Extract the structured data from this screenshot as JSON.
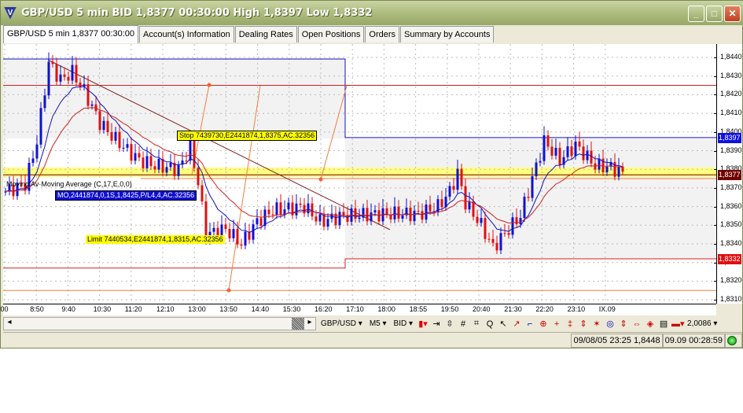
{
  "window": {
    "title": "GBP/USD 5 min BID 1,8377 00:30:00 High 1,8397 Low 1,8332",
    "logo": "FX",
    "buttons": [
      "minimize",
      "maximize",
      "close"
    ]
  },
  "tabs": [
    {
      "label": "GBP/USD 5 min 1,8377 00:30:00",
      "active": true
    },
    {
      "label": "Account(s) Information"
    },
    {
      "label": "Dealing Rates"
    },
    {
      "label": "Open Positions"
    },
    {
      "label": "Orders"
    },
    {
      "label": "Summary by Accounts"
    }
  ],
  "chart": {
    "price_labels": [
      "1,8440",
      "1,8430",
      "1,8420",
      "1,8410",
      "1,8400",
      "1,8390",
      "1,8380",
      "1,8370",
      "1,8360",
      "1,8350",
      "1,8340",
      "1,8330",
      "1,8320",
      "1,8310"
    ],
    "price_values": [
      1.844,
      1.843,
      1.842,
      1.841,
      1.84,
      1.839,
      1.838,
      1.837,
      1.836,
      1.835,
      1.834,
      1.833,
      1.832,
      1.831
    ],
    "badges": [
      {
        "text": "1,8397",
        "value": 1.8397,
        "color": "#1010e0"
      },
      {
        "text": "1,8377",
        "value": 1.8377,
        "color": "#700000"
      },
      {
        "text": "1,8332",
        "value": 1.8332,
        "color": "#e01010"
      }
    ],
    "time_labels": [
      ":00",
      "8:50",
      "9:40",
      "10:30",
      "11:20",
      "12:10",
      "13:00",
      "13:50",
      "14:40",
      "15:30",
      "16:20",
      "17:10",
      "18:00",
      "18:55",
      "19:50",
      "20:40",
      "21:30",
      "22:20",
      "23:10",
      "IX.09"
    ],
    "indicator_label": "Moving Av·Moving Average (C,17,E,0,0)",
    "position_label": "MO,2441874,0,1S,1,8425,P/L4,4,AC.32356",
    "stop_label": "Stop 7439730,E2441874,1,8375,AC.32356",
    "limit_label": "Limit 7440534,E2441874,1,8315,AC.32356",
    "price_keypoints": [
      [
        0,
        1.8368
      ],
      [
        5,
        1.8372
      ],
      [
        8,
        1.8395
      ],
      [
        11,
        1.8437
      ],
      [
        14,
        1.8428
      ],
      [
        17,
        1.8432
      ],
      [
        20,
        1.8422
      ],
      [
        24,
        1.8405
      ],
      [
        27,
        1.8398
      ],
      [
        30,
        1.8392
      ],
      [
        34,
        1.8385
      ],
      [
        38,
        1.8382
      ],
      [
        44,
        1.838
      ],
      [
        47,
        1.8392
      ],
      [
        49,
        1.8373
      ],
      [
        51,
        1.8345
      ],
      [
        56,
        1.8348
      ],
      [
        60,
        1.834
      ],
      [
        64,
        1.8352
      ],
      [
        68,
        1.8358
      ],
      [
        76,
        1.836
      ],
      [
        80,
        1.8352
      ],
      [
        86,
        1.8355
      ],
      [
        95,
        1.8356
      ],
      [
        105,
        1.8356
      ],
      [
        110,
        1.836
      ],
      [
        113,
        1.8368
      ],
      [
        115,
        1.8378
      ],
      [
        117,
        1.8362
      ],
      [
        121,
        1.835
      ],
      [
        124,
        1.8338
      ],
      [
        128,
        1.8348
      ],
      [
        131,
        1.8355
      ],
      [
        134,
        1.8375
      ],
      [
        137,
        1.8395
      ],
      [
        141,
        1.8385
      ],
      [
        145,
        1.8393
      ],
      [
        150,
        1.8382
      ],
      [
        154,
        1.8381
      ],
      [
        157,
        1.8378
      ]
    ],
    "colors": {
      "up": "#1010d0",
      "down": "#e01010",
      "ma_fast": "#1010c0",
      "ma_slow": "#d02020",
      "band": "#ffff80"
    }
  },
  "toolbar": {
    "symbol": "GBP/USD",
    "timeframe": "M5",
    "side": "BID",
    "zoom_value": "2,0086"
  },
  "status": {
    "datetime": "09/08/05 23:25",
    "price": "1,8448",
    "server_time": "09.09 00:28:59"
  }
}
